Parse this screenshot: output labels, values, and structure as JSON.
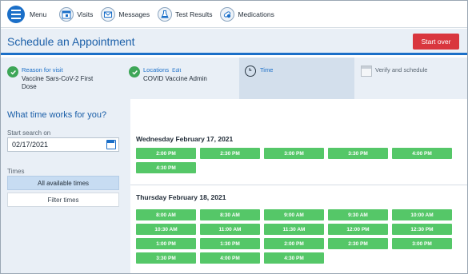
{
  "nav": {
    "menu": "Menu",
    "visits": "Visits",
    "messages": "Messages",
    "test_results": "Test Results",
    "medications": "Medications"
  },
  "header": {
    "title": "Schedule an Appointment",
    "start_over": "Start over"
  },
  "steps": [
    {
      "label": "Reason for visit",
      "value": "Vaccine Sars-CoV-2 First Dose"
    },
    {
      "label": "Locations",
      "edit": "Edit",
      "value": "COVID Vaccine Admin"
    },
    {
      "label": "Time"
    },
    {
      "label": "Verify and schedule"
    }
  ],
  "search": {
    "question": "What time works for you?",
    "start_label": "Start search on",
    "start_value": "02/17/2021",
    "times_label": "Times",
    "all_times": "All available times",
    "filter_times": "Filter times"
  },
  "days": [
    {
      "title": "Wednesday February 17, 2021",
      "slots": [
        "2:00 PM",
        "2:30 PM",
        "3:00 PM",
        "3:30 PM",
        "4:00 PM",
        "4:30 PM"
      ]
    },
    {
      "title": "Thursday February 18, 2021",
      "slots": [
        "8:00 AM",
        "8:30 AM",
        "9:00 AM",
        "9:30 AM",
        "10:00 AM",
        "10:30 AM",
        "11:00 AM",
        "11:30 AM",
        "12:00 PM",
        "12:30 PM",
        "1:00 PM",
        "1:30 PM",
        "2:00 PM",
        "2:30 PM",
        "3:00 PM",
        "3:30 PM",
        "4:00 PM",
        "4:30 PM"
      ]
    }
  ],
  "colors": {
    "accent": "#1b6fc8",
    "start_over": "#d9363e",
    "slot": "#55c768",
    "check": "#3da657"
  }
}
